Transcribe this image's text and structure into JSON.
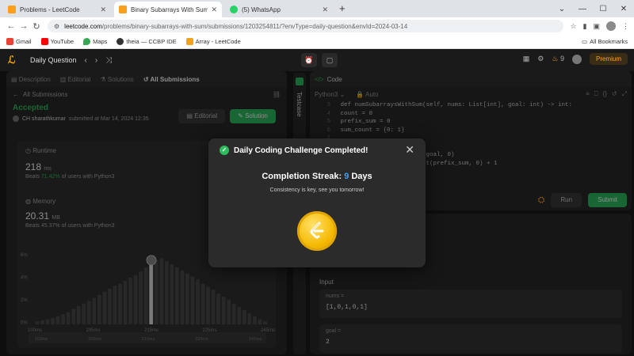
{
  "browser": {
    "tabs": [
      {
        "title": "Problems - LeetCode",
        "fav_color": "#f89f1b",
        "active": false
      },
      {
        "title": "Binary Subarrays With Sum - Le",
        "fav_color": "#f89f1b",
        "active": true
      },
      {
        "title": "(5) WhatsApp",
        "fav_color": "#25d366",
        "active": false
      }
    ],
    "new_tab": "+",
    "url_domain": "leetcode.com",
    "url_path": "/problems/binary-subarrays-with-sum/submissions/1203254811/?envType=daily-question&envId=2024-03-14",
    "bookmarks": [
      {
        "label": "Gmail",
        "color": "#ea4335"
      },
      {
        "label": "YouTube",
        "color": "#ff0000"
      },
      {
        "label": "Maps",
        "color": "#34a853"
      },
      {
        "label": "theia — CCBP IDE",
        "color": "#333333"
      },
      {
        "label": "Array - LeetCode",
        "color": "#f89f1b"
      }
    ],
    "all_bookmarks": "All Bookmarks"
  },
  "nav": {
    "logo_glyph": "ℒ",
    "daily_question": "Daily Question",
    "streak_count": "9",
    "premium": "Premium"
  },
  "left": {
    "tabs": [
      "Description",
      "Editorial",
      "Solutions",
      "All Submissions"
    ],
    "sub_label": "All Submissions",
    "status": "Accepted",
    "user": "CH sharathkumar",
    "submitted": "submitted at Mar 14, 2024 12:35",
    "editorial_btn": "Editorial",
    "solution_btn": "Solution",
    "runtime_label": "Runtime",
    "runtime_value": "218",
    "runtime_unit": "ms",
    "runtime_beats_prefix": "Beats",
    "runtime_beats": "71.42%",
    "runtime_beats_suffix": "of users with Python3",
    "memory_label": "Memory",
    "memory_value": "20.31",
    "memory_unit": "MB",
    "memory_beats_prefix": "Beats",
    "memory_beats": "45.37%",
    "memory_beats_suffix": "of users with Python3"
  },
  "chart_data": {
    "type": "bar",
    "x_ticks": [
      "100ms",
      "205ms",
      "215ms",
      "225ms",
      "245ms"
    ],
    "y_ticks": [
      "6%",
      "4%",
      "2%",
      "0%"
    ],
    "mini_ticks": [
      "163ms",
      "205ms",
      "215ms",
      "225ms",
      "245ms"
    ],
    "values": [
      0.3,
      0.4,
      0.5,
      0.6,
      0.8,
      1.0,
      1.2,
      1.5,
      1.8,
      2.0,
      2.3,
      2.6,
      2.9,
      3.2,
      3.5,
      3.8,
      4.0,
      4.3,
      4.6,
      4.8,
      5.2,
      5.6,
      6.0,
      6.3,
      6.5,
      6.2,
      5.9,
      5.6,
      5.3,
      5.0,
      4.7,
      4.4,
      4.0,
      3.7,
      3.4,
      3.0,
      2.7,
      2.4,
      2.0,
      1.7,
      1.4,
      1.1,
      0.8,
      0.5,
      0.3
    ],
    "highlight_index": 22,
    "ylim": [
      0,
      7
    ]
  },
  "code": {
    "title": "Code",
    "language": "Python3",
    "auto": "Auto",
    "lines": [
      {
        "n": "3",
        "t": "    def numSubarraysWithSum(self, nums: List[int], goal: int) -> int:"
      },
      {
        "n": "4",
        "t": "        count = 0"
      },
      {
        "n": "5",
        "t": "        prefix_sum = 0"
      },
      {
        "n": "6",
        "t": "        sum_count = {0: 1}"
      },
      {
        "n": "7",
        "t": ""
      },
      {
        "n": "8",
        "t": "            ...um"
      },
      {
        "n": "9",
        "t": "            ...unt.get(prefix_sum - goal, 0)"
      },
      {
        "n": "10",
        "t": "            ...t_sum] = sum_count.get(prefix_sum, 0) + 1"
      }
    ],
    "run": "Run",
    "submit": "Submit"
  },
  "testcase": {
    "rail_label": "Testcase",
    "input_label": "Input",
    "fields": [
      {
        "name": "nums =",
        "value": "[1,0,1,0,1]"
      },
      {
        "name": "goal =",
        "value": "2"
      }
    ]
  },
  "modal": {
    "title": "Daily Coding Challenge Completed!",
    "streak_prefix": "Completion Streak:",
    "streak_num": "9",
    "streak_suffix": "Days",
    "tagline": "Consistency is key, see you tomorrow!"
  }
}
